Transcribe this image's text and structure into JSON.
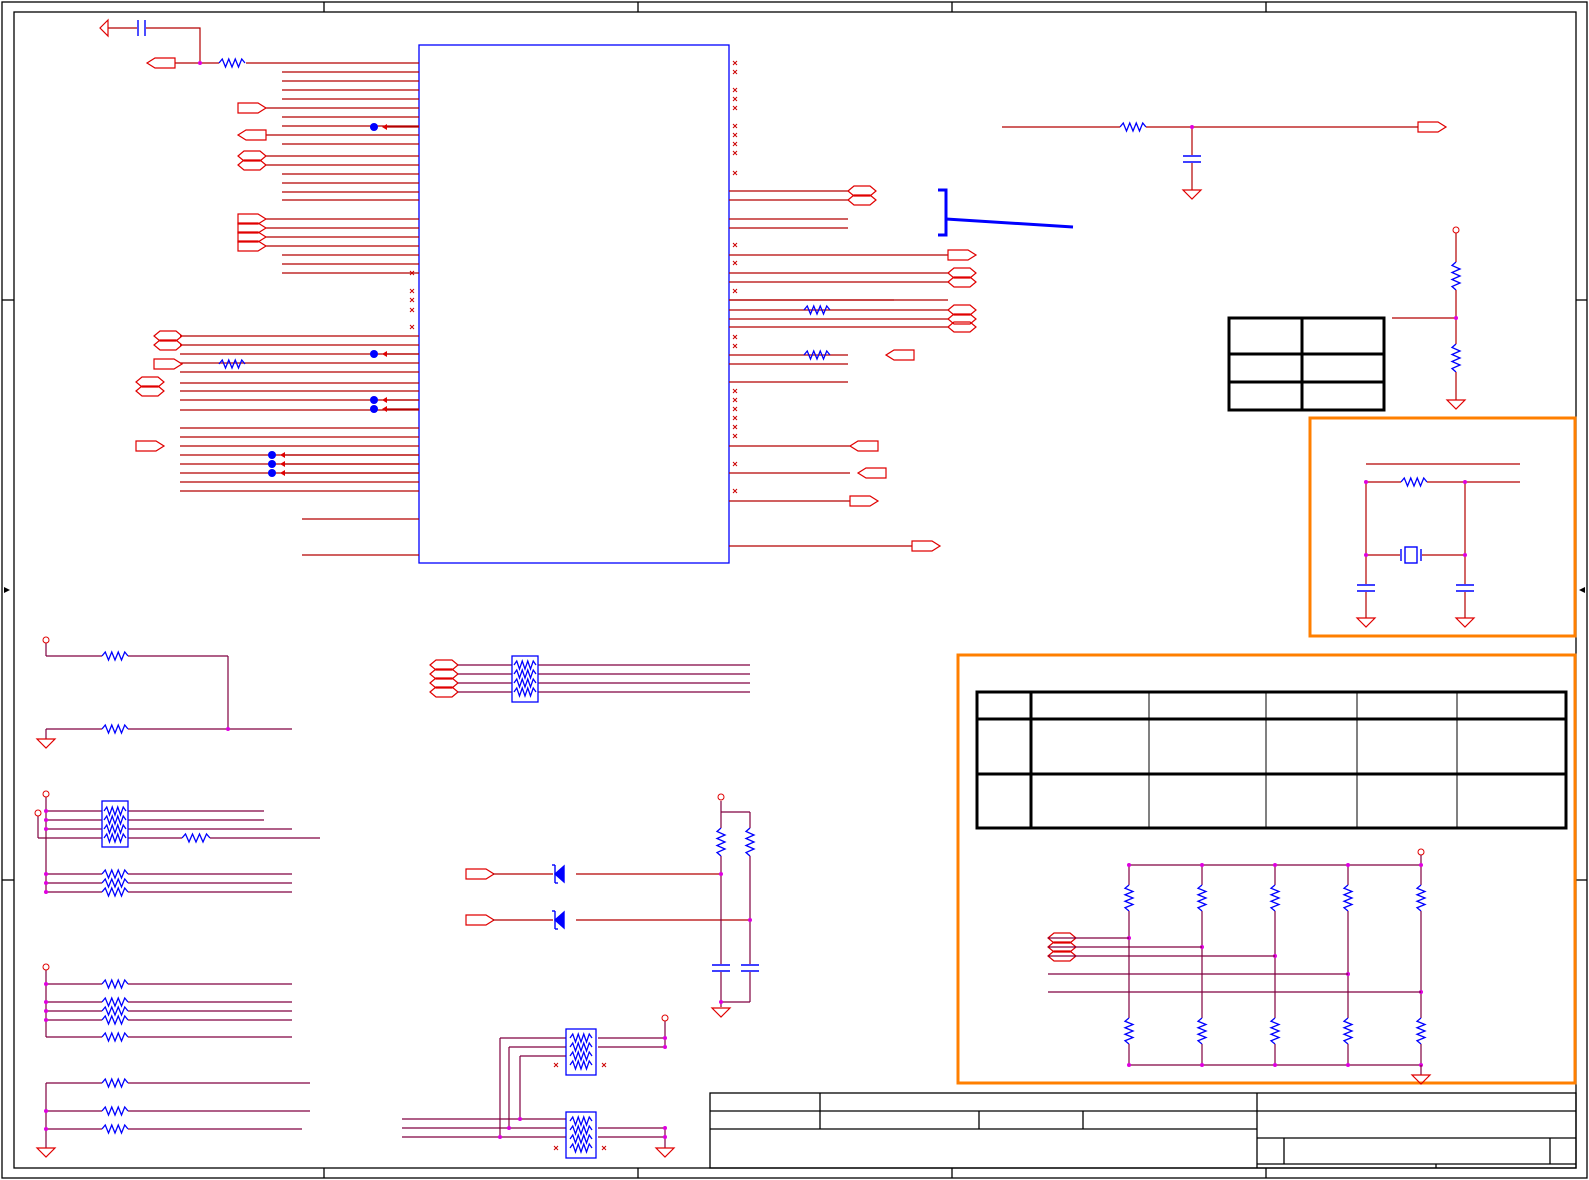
{
  "colors": {
    "frame": "#000000",
    "net_wire": "#b40000",
    "bus_wire": "#800040",
    "component": "#0000ff",
    "off_page": "#e00000",
    "junction": "#e000e0",
    "highlight_box": "#ff7f00",
    "no_connect": "#cc0000"
  },
  "symbols": {
    "resistor": "resistor-zigzag-icon",
    "capacitor": "capacitor-icon",
    "ground": "ground-triangle-icon",
    "power": "power-pin-circle-icon",
    "crystal": "crystal-icon",
    "diode": "diode-icon",
    "off_page_connector": "off-page-arrow-icon",
    "resistor_pack": "resistor-array-icon",
    "test_point": "test-point-dot-icon",
    "no_connect": "no-connect-x-icon"
  },
  "sections": [
    "main-ic",
    "reset-rc-filter",
    "strap-option-table",
    "crystal-oscillator",
    "strap-resistor-matrix",
    "pull-up-networks",
    "diode-isolation",
    "resistor-pack-group",
    "title-block"
  ]
}
